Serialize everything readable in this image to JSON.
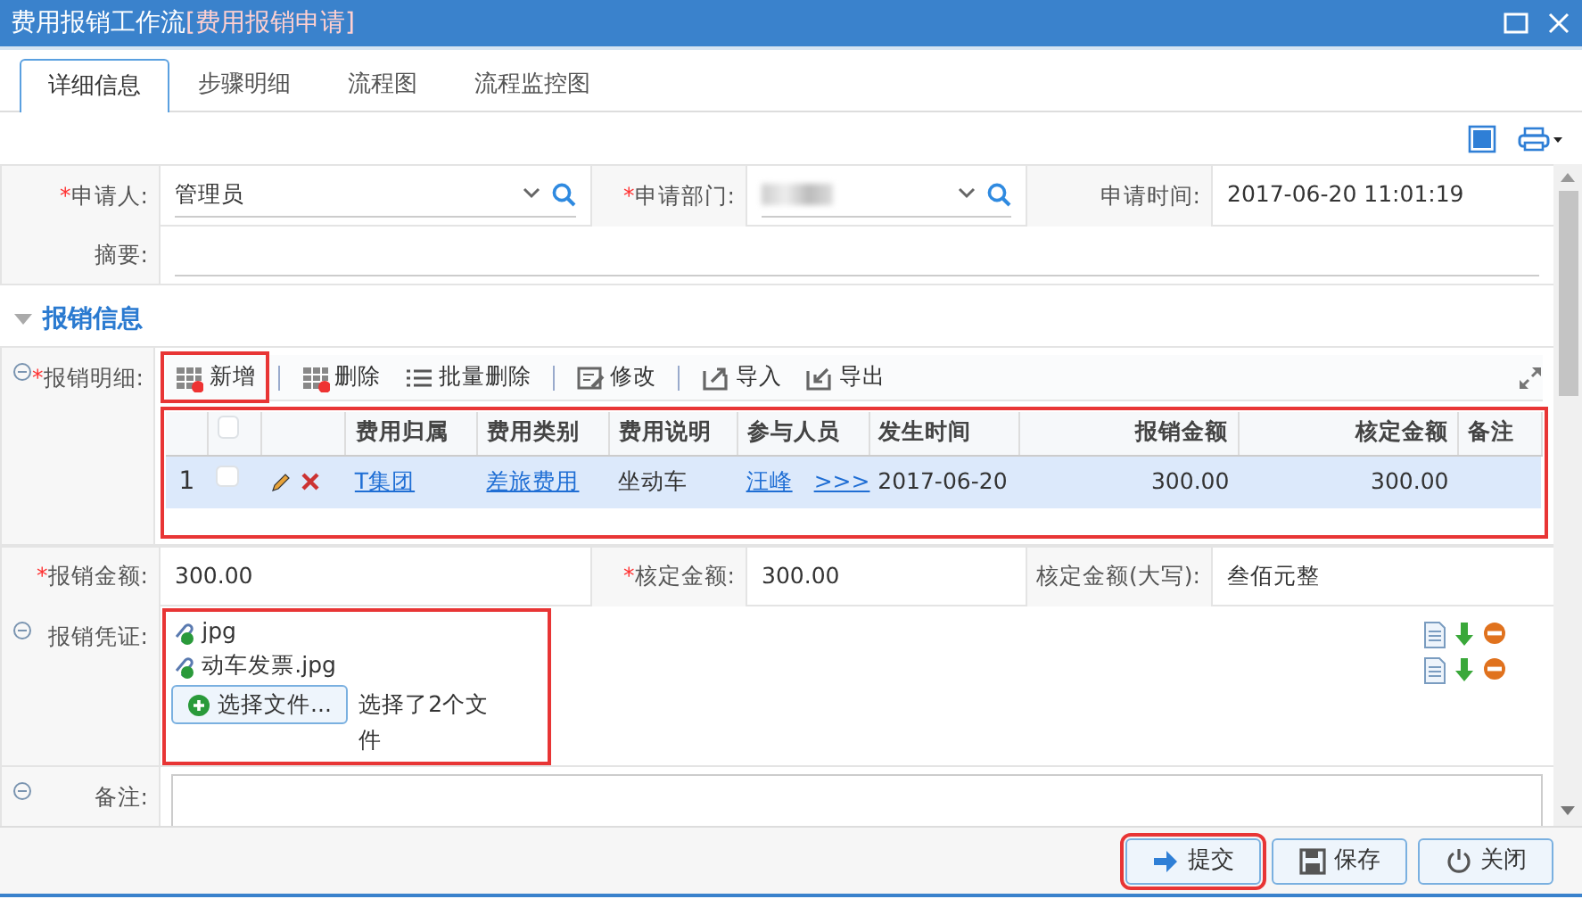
{
  "window": {
    "title": "费用报销工作流",
    "subtitle": "[费用报销申请]"
  },
  "tabs": [
    {
      "label": "详细信息",
      "selected": true
    },
    {
      "label": "步骤明细",
      "selected": false
    },
    {
      "label": "流程图",
      "selected": false
    },
    {
      "label": "流程监控图",
      "selected": false
    }
  ],
  "form": {
    "applicant": {
      "mark": "*",
      "label": "申请人:",
      "value": "管理员"
    },
    "department": {
      "mark": "*",
      "label": "申请部门:"
    },
    "apply_time": {
      "label": "申请时间:",
      "value": "2017-06-20 11:01:19"
    },
    "summary": {
      "label": "摘要:"
    }
  },
  "section": {
    "title": "报销信息",
    "expanded": true
  },
  "detail": {
    "mark": "*",
    "label": "报销明细:",
    "toolbar": [
      {
        "label": "新增",
        "highlighted": true
      },
      {
        "label": "删除",
        "highlighted": false
      },
      {
        "label": "批量删除",
        "highlighted": false
      },
      {
        "label": "修改",
        "highlighted": false
      },
      {
        "label": "导入",
        "highlighted": false
      },
      {
        "label": "导出",
        "highlighted": false
      }
    ],
    "table": {
      "highlighted": true,
      "header_checked": false,
      "columns": [
        {
          "label": "费用归属",
          "kind": "text"
        },
        {
          "label": "费用类别",
          "kind": "text"
        },
        {
          "label": "费用说明",
          "kind": "text"
        },
        {
          "label": "参与人员",
          "kind": "text"
        },
        {
          "label": "发生时间",
          "kind": "text"
        },
        {
          "label": "报销金额",
          "kind": "amount"
        },
        {
          "label": "核定金额",
          "kind": "amount"
        },
        {
          "label": "备注",
          "kind": "text"
        }
      ],
      "rows": [
        {
          "index": "1",
          "checked": false,
          "selected": true,
          "cells": [
            {
              "text": "T集团",
              "link": true
            },
            {
              "text": "差旅费用",
              "link": true
            },
            {
              "text": "坐动车",
              "link": false
            },
            {
              "text": "汪峰",
              "link": true,
              "more": ">>>"
            },
            {
              "text": "2017-06-20",
              "link": false
            },
            {
              "text": "300.00",
              "link": false
            },
            {
              "text": "300.00",
              "link": false
            }
          ]
        }
      ]
    }
  },
  "amounts": [
    {
      "mark": "*",
      "label": "报销金额:",
      "value": "300.00"
    },
    {
      "mark": "*",
      "label": "核定金额:",
      "value": "300.00"
    },
    {
      "label": "核定金额(大写):",
      "value": "叁佰元整"
    }
  ],
  "attachments": {
    "label": "报销凭证:",
    "highlighted": true,
    "files": [
      {
        "name": "jpg"
      },
      {
        "name": "动车发票.jpg"
      }
    ],
    "choose_button": "选择文件...",
    "status": "选择了2个文件"
  },
  "remarks": {
    "label": "备注:"
  },
  "buttons": [
    {
      "label": "提交",
      "highlighted": true
    },
    {
      "label": "保存",
      "highlighted": false
    },
    {
      "label": "关闭",
      "highlighted": false
    }
  ]
}
